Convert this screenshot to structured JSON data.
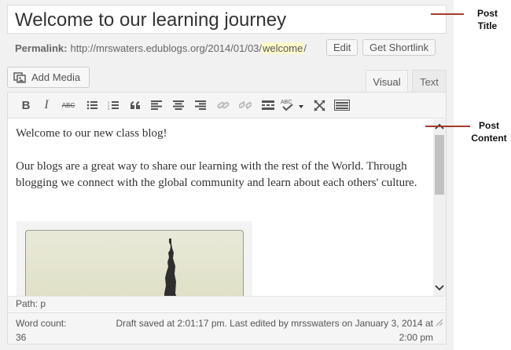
{
  "post": {
    "title": "Welcome to our learning journey",
    "permalink_label": "Permalink:",
    "permalink_base": "http://mrswaters.edublogs.org/2014/01/03/",
    "permalink_slug": "welcome",
    "permalink_end": "/",
    "edit_label": "Edit",
    "shortlink_label": "Get Shortlink"
  },
  "media": {
    "add_label": "Add Media"
  },
  "tabs": {
    "visual": "Visual",
    "text": "Text",
    "active": "Visual"
  },
  "toolbar": {
    "buttons": [
      "bold-icon",
      "italic-icon",
      "strikethrough-icon",
      "bullet-list-icon",
      "numbered-list-icon",
      "blockquote-icon",
      "align-left-icon",
      "align-center-icon",
      "align-right-icon",
      "link-icon",
      "unlink-icon",
      "read-more-icon",
      "spellcheck-icon",
      "fullscreen-icon",
      "kitchen-sink-icon"
    ],
    "bold": "B",
    "italic": "I",
    "strike": "ABC",
    "spell": "ABC"
  },
  "content": {
    "p1": "Welcome to our new class blog!",
    "p2": "Our blogs are a great way to share our learning with the rest of the World. Through blogging we connect with the global community and learn about each others' culture."
  },
  "path": {
    "text": "Path: p"
  },
  "status": {
    "word_count_label": "Word count:",
    "word_count": "36",
    "draft_line1": "Draft saved at 2:01:17 pm. Last edited by mrsswaters on January 3, 2014 at",
    "draft_line2": "2:00 pm"
  },
  "annotations": {
    "title_line1": "Post",
    "title_line2": "Title",
    "content_line1": "Post",
    "content_line2": "Content"
  },
  "colors": {
    "annotation_line": "#a23b2d",
    "slug_highlight": "#fffbcc"
  }
}
